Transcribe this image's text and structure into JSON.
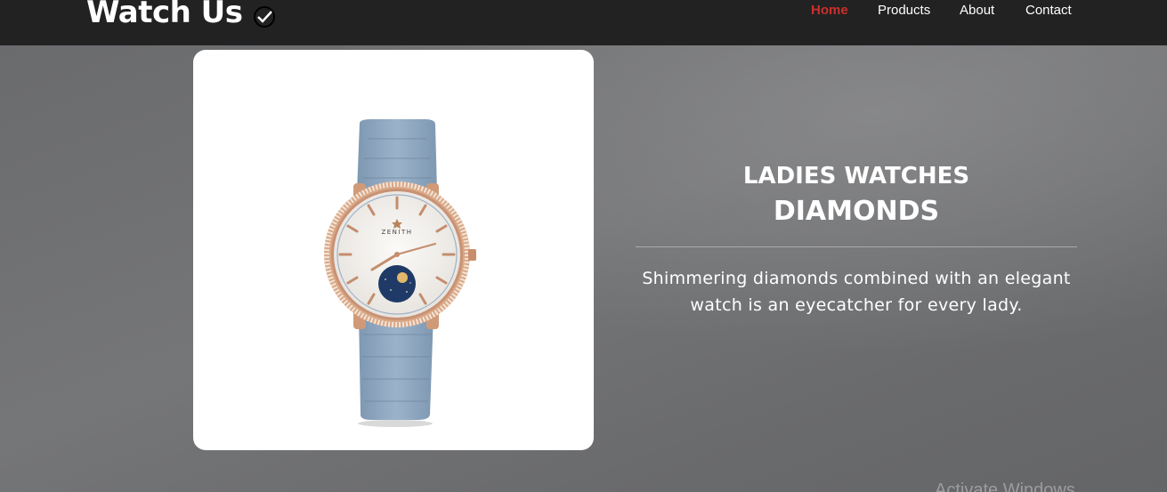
{
  "navbar": {
    "brand": "Watch Us",
    "brand_icon": "check-circle-icon",
    "links": [
      {
        "label": "Home",
        "active": true
      },
      {
        "label": "Products",
        "active": false
      },
      {
        "label": "About",
        "active": false
      },
      {
        "label": "Contact",
        "active": false
      }
    ]
  },
  "hero": {
    "product_image": {
      "dial_brand": "ZENITH",
      "description_icon": "watch-image"
    },
    "category": "LADIES WATCHES",
    "title": "DIAMONDS",
    "description": "Shimmering diamonds combined with an elegant watch is an eyecatcher for every lady."
  },
  "system": {
    "watermark": "Activate Windows"
  },
  "colors": {
    "navbar_bg": "#222222",
    "active_link": "#c9302c",
    "hero_bg": "#6e6f71",
    "strap": "#8ea7bf",
    "case": "#d4a080",
    "moon_dial": "#1f3a66"
  }
}
